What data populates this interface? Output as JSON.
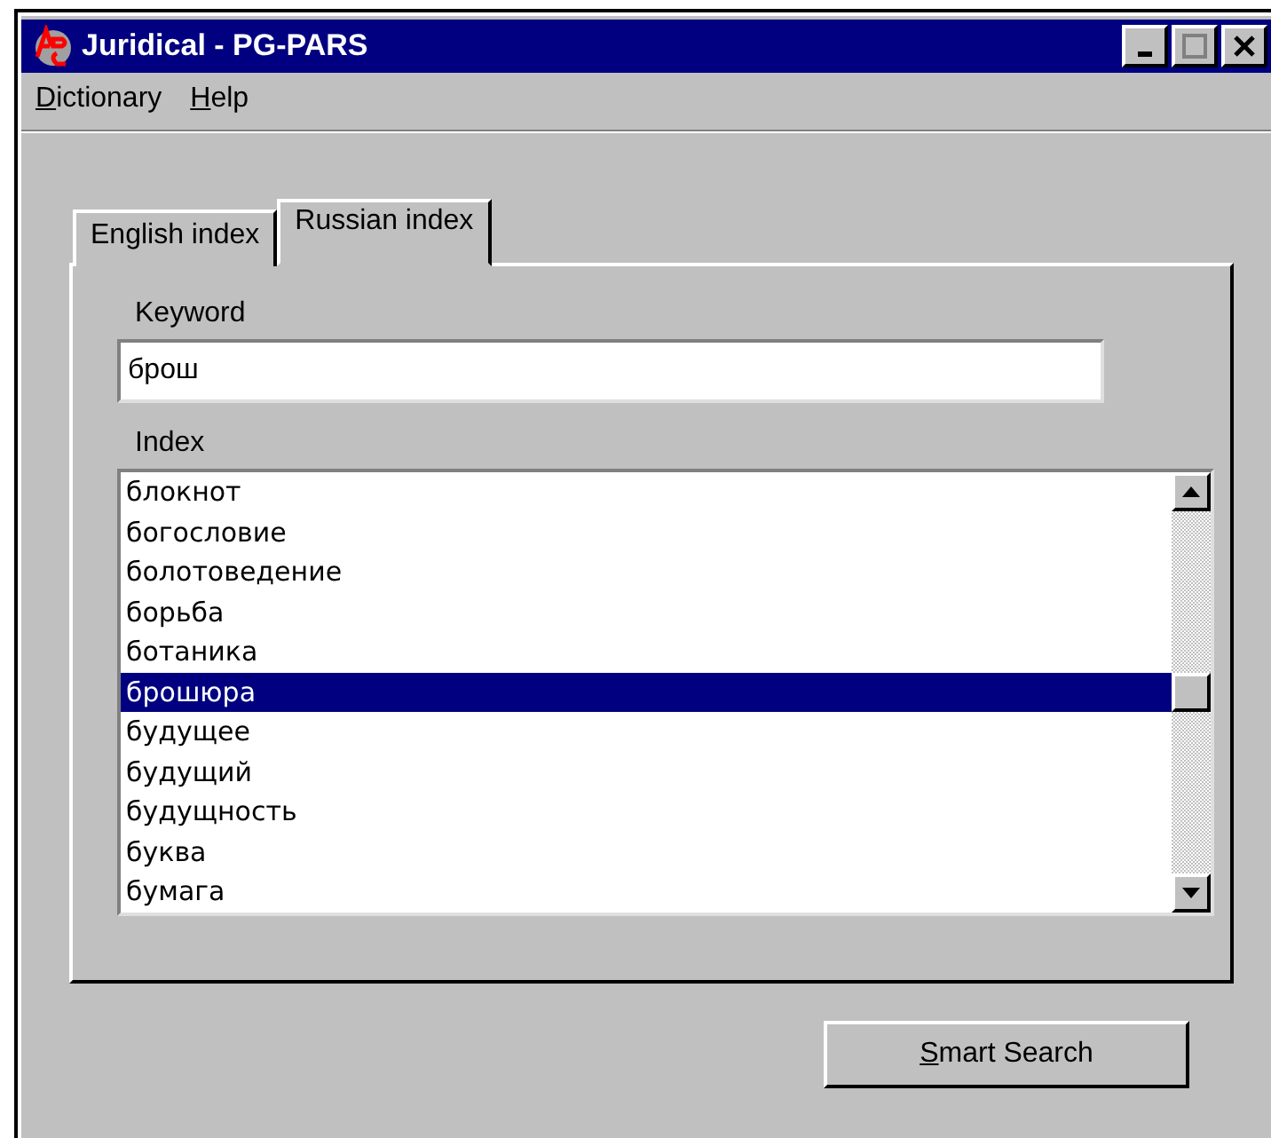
{
  "window": {
    "title": "Juridical - PG-PARS"
  },
  "menu": [
    "Dictionary",
    "Help"
  ],
  "tabs": [
    {
      "label": "English index",
      "selected": false
    },
    {
      "label": "Russian index",
      "selected": true
    }
  ],
  "keyword": {
    "label": "Keyword",
    "value": "брош"
  },
  "index": {
    "label": "Index",
    "items": [
      {
        "text": "блокнот",
        "selected": false
      },
      {
        "text": "богословие",
        "selected": false
      },
      {
        "text": "болотоведение",
        "selected": false
      },
      {
        "text": "борьба",
        "selected": false
      },
      {
        "text": "ботаника",
        "selected": false
      },
      {
        "text": "брошюра",
        "selected": true
      },
      {
        "text": "будущее",
        "selected": false
      },
      {
        "text": "будущий",
        "selected": false
      },
      {
        "text": "будущность",
        "selected": false
      },
      {
        "text": "буква",
        "selected": false
      },
      {
        "text": "бумага",
        "selected": false
      }
    ]
  },
  "buttons": [
    "Smart Search"
  ]
}
